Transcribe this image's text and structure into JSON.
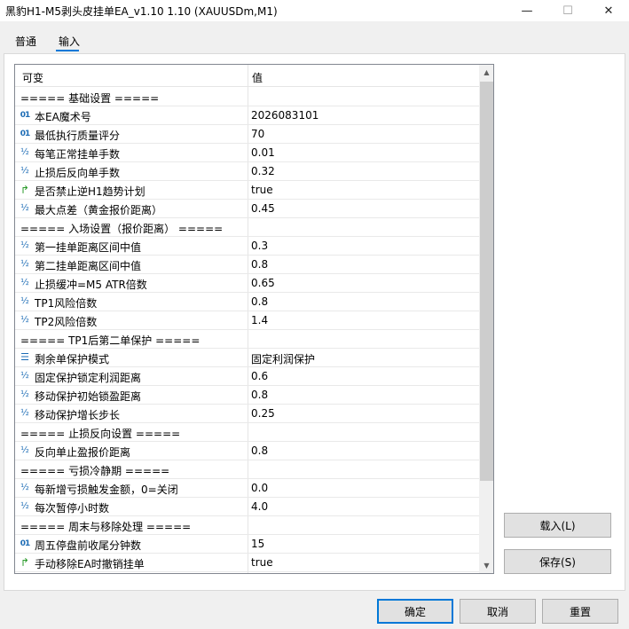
{
  "window": {
    "title": "黑豹H1-M5剥头皮挂单EA_v1.10 1.10 (XAUUSDm,M1)",
    "min_glyph": "—",
    "max_glyph": "☐",
    "close_glyph": "✕"
  },
  "tabs": [
    "普通",
    "输入"
  ],
  "grid": {
    "col_variable": "可变",
    "col_value": "值",
    "rows": [
      {
        "type": "section",
        "name": "===== 基础设置 =====",
        "value": ""
      },
      {
        "type": "int",
        "name": "本EA魔术号",
        "value": "2026083101"
      },
      {
        "type": "int",
        "name": "最低执行质量评分",
        "value": "70"
      },
      {
        "type": "double",
        "name": "每笔正常挂单手数",
        "value": "0.01"
      },
      {
        "type": "double",
        "name": "止损后反向单手数",
        "value": "0.32"
      },
      {
        "type": "bool",
        "name": "是否禁止逆H1趋势计划",
        "value": "true"
      },
      {
        "type": "double",
        "name": "最大点差（黄金报价距离）",
        "value": "0.45"
      },
      {
        "type": "section",
        "name": "===== 入场设置（报价距离） =====",
        "value": ""
      },
      {
        "type": "double",
        "name": "第一挂单距离区间中值",
        "value": "0.3"
      },
      {
        "type": "double",
        "name": "第二挂单距离区间中值",
        "value": "0.8"
      },
      {
        "type": "double",
        "name": "止损缓冲=M5 ATR倍数",
        "value": "0.65"
      },
      {
        "type": "double",
        "name": "TP1风险倍数",
        "value": "0.8"
      },
      {
        "type": "double",
        "name": "TP2风险倍数",
        "value": "1.4"
      },
      {
        "type": "section",
        "name": "===== TP1后第二单保护 =====",
        "value": ""
      },
      {
        "type": "enum",
        "name": "剩余单保护模式",
        "value": "固定利润保护"
      },
      {
        "type": "double",
        "name": "固定保护锁定利润距离",
        "value": "0.6"
      },
      {
        "type": "double",
        "name": "移动保护初始锁盈距离",
        "value": "0.8"
      },
      {
        "type": "double",
        "name": "移动保护增长步长",
        "value": "0.25"
      },
      {
        "type": "section",
        "name": "===== 止损反向设置 =====",
        "value": ""
      },
      {
        "type": "double",
        "name": "反向单止盈报价距离",
        "value": "0.8"
      },
      {
        "type": "section",
        "name": "===== 亏损冷静期 =====",
        "value": ""
      },
      {
        "type": "double",
        "name": "每新增亏损触发金额，0=关闭",
        "value": "0.0"
      },
      {
        "type": "double",
        "name": "每次暂停小时数",
        "value": "4.0"
      },
      {
        "type": "section",
        "name": "===== 周末与移除处理 =====",
        "value": ""
      },
      {
        "type": "int",
        "name": "周五停盘前收尾分钟数",
        "value": "15"
      },
      {
        "type": "bool",
        "name": "手动移除EA时撤销挂单",
        "value": "true"
      }
    ]
  },
  "icons": {
    "int": "01",
    "double": "½",
    "bool": "↱",
    "enum": "☰"
  },
  "buttons": {
    "load": "载入(L)",
    "save": "保存(S)",
    "ok": "确定",
    "cancel": "取消",
    "reset": "重置"
  },
  "colors": {
    "accent": "#0078d7",
    "icon_blue": "#1c6cb5",
    "icon_green": "#2a9a2a"
  }
}
